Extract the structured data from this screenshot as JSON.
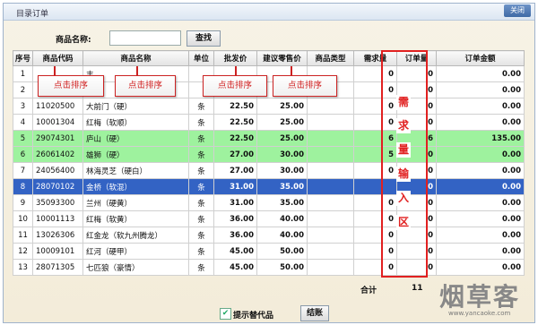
{
  "window": {
    "title": "目录订单",
    "close_label": "关闭"
  },
  "search": {
    "label": "商品名称:",
    "value": "",
    "button": "查找"
  },
  "table": {
    "headers": [
      "序号",
      "商品代码",
      "商品名称",
      "单位",
      "批发价",
      "建议零售价",
      "商品类型",
      "需求量",
      "订单量",
      "订单金额"
    ],
    "rows": [
      {
        "seq": "1",
        "code": "",
        "name": "丰",
        "unit": "",
        "price": "",
        "retail": "",
        "type": "",
        "demand": "0",
        "order": "0",
        "amount": "0.00"
      },
      {
        "seq": "2",
        "code": "",
        "name": "宝",
        "unit": "",
        "price": "",
        "retail": "",
        "type": "",
        "demand": "0",
        "order": "0",
        "amount": "0.00"
      },
      {
        "seq": "3",
        "code": "11020500",
        "name": "大前门（硬）",
        "unit": "条",
        "price": "22.50",
        "retail": "25.00",
        "type": "",
        "demand": "0",
        "order": "0",
        "amount": "0.00"
      },
      {
        "seq": "4",
        "code": "10001304",
        "name": "红梅（软顺）",
        "unit": "条",
        "price": "22.50",
        "retail": "25.00",
        "type": "",
        "demand": "0",
        "order": "0",
        "amount": "0.00"
      },
      {
        "seq": "5",
        "code": "29074301",
        "name": "庐山（硬）",
        "unit": "条",
        "price": "22.50",
        "retail": "25.00",
        "type": "",
        "demand": "6",
        "order": "6",
        "amount": "135.00"
      },
      {
        "seq": "6",
        "code": "26061402",
        "name": "雄狮（硬）",
        "unit": "条",
        "price": "27.00",
        "retail": "30.00",
        "type": "",
        "demand": "5",
        "order": "0",
        "amount": "0.00"
      },
      {
        "seq": "7",
        "code": "24056400",
        "name": "林海灵芝（硬白）",
        "unit": "条",
        "price": "27.00",
        "retail": "30.00",
        "type": "",
        "demand": "0",
        "order": "0",
        "amount": "0.00"
      },
      {
        "seq": "8",
        "code": "28070102",
        "name": "金桥（软混）",
        "unit": "条",
        "price": "31.00",
        "retail": "35.00",
        "type": "",
        "demand": "",
        "order": "0",
        "amount": "0.00"
      },
      {
        "seq": "9",
        "code": "35093300",
        "name": "兰州（硬黄）",
        "unit": "条",
        "price": "31.00",
        "retail": "35.00",
        "type": "",
        "demand": "0",
        "order": "0",
        "amount": "0.00"
      },
      {
        "seq": "10",
        "code": "10001113",
        "name": "红梅（软黄）",
        "unit": "条",
        "price": "36.00",
        "retail": "40.00",
        "type": "",
        "demand": "0",
        "order": "0",
        "amount": "0.00"
      },
      {
        "seq": "11",
        "code": "13026306",
        "name": "红金龙（软九州腾龙）",
        "unit": "条",
        "price": "36.00",
        "retail": "40.00",
        "type": "",
        "demand": "0",
        "order": "0",
        "amount": "0.00"
      },
      {
        "seq": "12",
        "code": "10009101",
        "name": "红河（硬甲）",
        "unit": "条",
        "price": "45.00",
        "retail": "50.00",
        "type": "",
        "demand": "0",
        "order": "0",
        "amount": "0.00"
      },
      {
        "seq": "13",
        "code": "28071305",
        "name": "七匹狼（豪情）",
        "unit": "条",
        "price": "45.00",
        "retail": "50.00",
        "type": "",
        "demand": "0",
        "order": "0",
        "amount": "0.00"
      }
    ],
    "row_states": {
      "5": "highlight-green",
      "6": "highlight-green",
      "8": "selected-blue"
    }
  },
  "annotations": {
    "sort_callout": "点击排序",
    "demand_callout_chars": [
      "需",
      "求",
      "量",
      "输",
      "入",
      "区"
    ]
  },
  "totals": {
    "label": "合计",
    "value": "11"
  },
  "footer": {
    "substitute_checked": true,
    "substitute_label": "提示替代品",
    "settle_button": "结账"
  },
  "watermark": {
    "text": "烟草客",
    "url": "www.yancaoke.com"
  },
  "colors": {
    "green_row": "#9ef29e",
    "selected_row": "#3363c4",
    "annotation_red": "#e12020"
  }
}
